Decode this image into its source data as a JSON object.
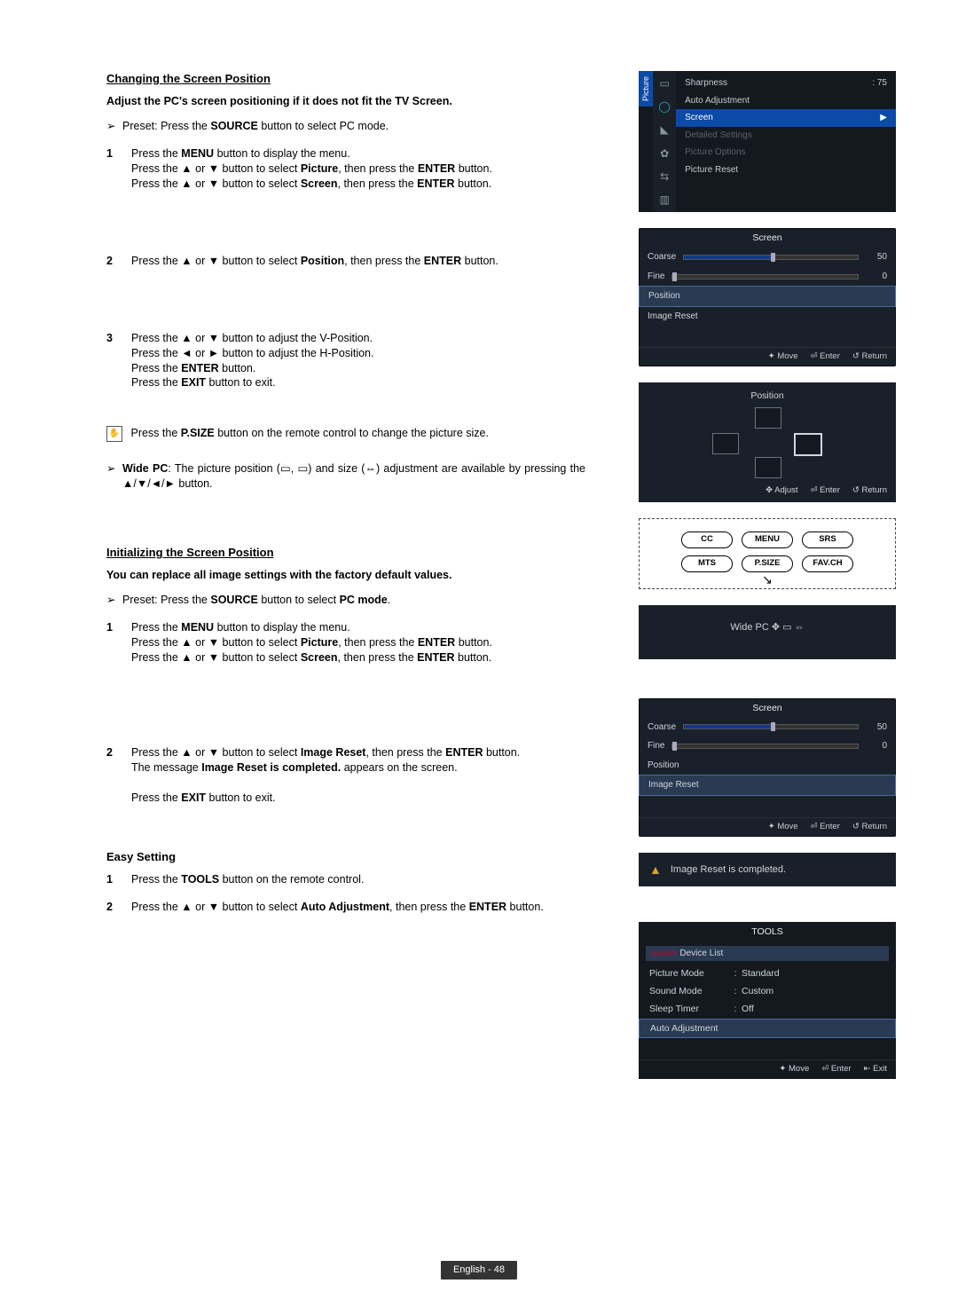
{
  "sec1": {
    "title": "Changing the Screen Position",
    "sub": "Adjust the PC's screen positioning if it does not fit the TV Screen.",
    "preset_a": "Preset: Press the ",
    "preset_b": "SOURCE",
    "preset_c": " button to select PC mode.",
    "step1": {
      "l1a": "Press the ",
      "l1b": "MENU",
      "l1c": " button to display the menu.",
      "l2a": "Press the ▲ or ▼ button to select ",
      "l2b": "Picture",
      "l2c": ", then press the ",
      "l2d": "ENTER",
      "l2e": " button.",
      "l3a": "Press the ▲ or ▼ button to select ",
      "l3b": "Screen",
      "l3c": ", then press the ",
      "l3d": "ENTER",
      "l3e": " button."
    },
    "step2": {
      "a": "Press the ▲ or ▼ button to select ",
      "b": "Position",
      "c": ", then press the ",
      "d": "ENTER",
      "e": " button."
    },
    "step3": {
      "l1": "Press the ▲ or ▼ button to adjust the V-Position.",
      "l2": "Press the ◄ or ► button to adjust the H-Position.",
      "l3a": "Press the ",
      "l3b": "ENTER",
      "l3c": " button.",
      "l4a": "Press the ",
      "l4b": "EXIT",
      "l4c": " button to exit."
    },
    "psize": {
      "a": "Press the ",
      "b": "P.SIZE",
      "c": " button on the remote control to change the picture size."
    },
    "widepc": {
      "a": "Wide PC",
      "b": ": The picture position (▭, ▭) and size (⇔) adjustment are available by pressing the ▲/▼/◄/► button."
    }
  },
  "sec2": {
    "title": "Initializing the Screen Position",
    "sub": "You can replace all image settings with the factory default values.",
    "preset_a": "Preset: Press the ",
    "preset_b": "SOURCE",
    "preset_c": " button to select ",
    "preset_d": "PC mode",
    "preset_e": ".",
    "step1": {
      "l1a": "Press the ",
      "l1b": "MENU",
      "l1c": " button to display the menu.",
      "l2a": "Press the ▲ or ▼ button to select ",
      "l2b": "Picture",
      "l2c": ", then press the ",
      "l2d": "ENTER",
      "l2e": " button.",
      "l3a": "Press the ▲ or ▼ button to select ",
      "l3b": "Screen",
      "l3c": ", then press the ",
      "l3d": "ENTER",
      "l3e": " button."
    },
    "step2": {
      "l1a": "Press the ▲ or ▼ button to select ",
      "l1b": "Image Reset",
      "l1c": ", then press the ",
      "l1d": "ENTER",
      "l1e": " button.",
      "l2a": "The message ",
      "l2b": "Image Reset is completed.",
      "l2c": " appears on the screen.",
      "l3a": "Press the ",
      "l3b": "EXIT",
      "l3c": " button to exit."
    }
  },
  "sec3": {
    "title": "Easy Setting",
    "step1": {
      "a": "Press the ",
      "b": "TOOLS",
      "c": " button on the remote control."
    },
    "step2": {
      "a": "Press the ▲ or ▼ button to select ",
      "b": "Auto Adjustment",
      "c": ", then press the ",
      "d": "ENTER",
      "e": " button."
    }
  },
  "pmenu": {
    "tab": "Picture",
    "sharpness": "Sharpness",
    "sharp_val": ": 75",
    "auto": "Auto Adjustment",
    "screen": "Screen",
    "detailed": "Detailed Settings",
    "options": "Picture Options",
    "reset": "Picture Reset"
  },
  "screen_osd": {
    "title": "Screen",
    "coarse": "Coarse",
    "coarse_val": "50",
    "fine": "Fine",
    "fine_val": "0",
    "position": "Position",
    "image_reset": "Image Reset",
    "move": "✦ Move",
    "enter": "⏎ Enter",
    "return": "↺ Return"
  },
  "pos_osd": {
    "title": "Position",
    "adjust": "✥ Adjust",
    "enter": "⏎ Enter",
    "return": "↺ Return"
  },
  "remote": {
    "cc": "CC",
    "menu": "MENU",
    "srs": "SRS",
    "mts": "MTS",
    "psize": "P.SIZE",
    "favch": "FAV.CH"
  },
  "widepc_osd": "Wide PC   ✥  ▭  ⇔",
  "msg": "Image Reset is completed.",
  "tools_osd": {
    "title": "TOOLS",
    "anynet": "Device List",
    "pm": "Picture Mode",
    "pm_v": "Standard",
    "sm": "Sound Mode",
    "sm_v": "Custom",
    "st": "Sleep Timer",
    "st_v": "Off",
    "auto": "Auto Adjustment",
    "move": "✦ Move",
    "enter": "⏎ Enter",
    "exit": "⇤ Exit"
  },
  "page": "English - 48"
}
